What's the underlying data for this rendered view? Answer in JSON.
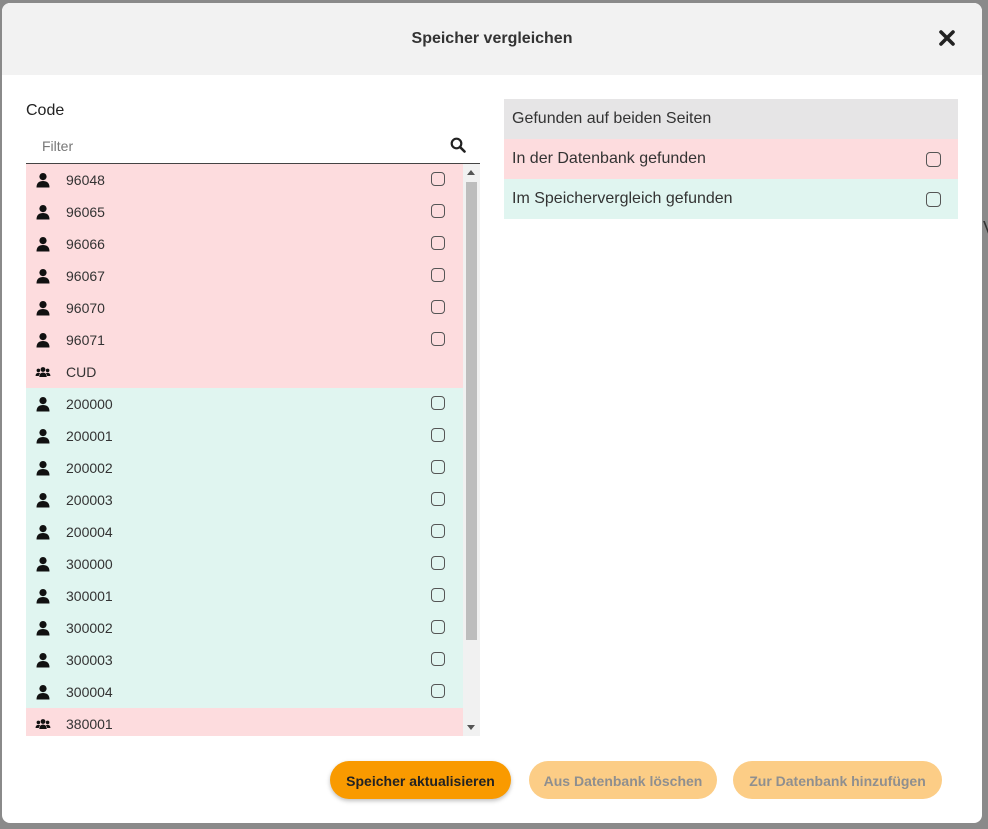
{
  "modal": {
    "title": "Speicher vergleichen"
  },
  "left": {
    "label": "Code",
    "filter_placeholder": "Filter",
    "rows": [
      {
        "code": "96048",
        "type": "user",
        "status": "db",
        "checkbox": true
      },
      {
        "code": "96065",
        "type": "user",
        "status": "db",
        "checkbox": true
      },
      {
        "code": "96066",
        "type": "user",
        "status": "db",
        "checkbox": true
      },
      {
        "code": "96067",
        "type": "user",
        "status": "db",
        "checkbox": true
      },
      {
        "code": "96070",
        "type": "user",
        "status": "db",
        "checkbox": true
      },
      {
        "code": "96071",
        "type": "user",
        "status": "db",
        "checkbox": true
      },
      {
        "code": "CUD",
        "type": "group",
        "status": "db",
        "checkbox": false
      },
      {
        "code": "200000",
        "type": "user",
        "status": "mem",
        "checkbox": true
      },
      {
        "code": "200001",
        "type": "user",
        "status": "mem",
        "checkbox": true
      },
      {
        "code": "200002",
        "type": "user",
        "status": "mem",
        "checkbox": true
      },
      {
        "code": "200003",
        "type": "user",
        "status": "mem",
        "checkbox": true
      },
      {
        "code": "200004",
        "type": "user",
        "status": "mem",
        "checkbox": true
      },
      {
        "code": "300000",
        "type": "user",
        "status": "mem",
        "checkbox": true
      },
      {
        "code": "300001",
        "type": "user",
        "status": "mem",
        "checkbox": true
      },
      {
        "code": "300002",
        "type": "user",
        "status": "mem",
        "checkbox": true
      },
      {
        "code": "300003",
        "type": "user",
        "status": "mem",
        "checkbox": true
      },
      {
        "code": "300004",
        "type": "user",
        "status": "mem",
        "checkbox": true
      },
      {
        "code": "380001",
        "type": "group",
        "status": "db",
        "checkbox": false
      }
    ]
  },
  "legend": {
    "both": "Gefunden auf beiden Seiten",
    "db": "In der Datenbank gefunden",
    "mem": "Im Speichervergleich gefunden"
  },
  "buttons": {
    "update": "Speicher aktualisieren",
    "delete": "Aus Datenbank löschen",
    "add": "Zur Datenbank hinzufügen"
  },
  "colors": {
    "db_row": "#fddcde",
    "mem_row": "#e0f5f0",
    "both_row": "#e6e5e6",
    "accent": "#f99a00"
  },
  "background": {
    "edge_text": "V"
  }
}
